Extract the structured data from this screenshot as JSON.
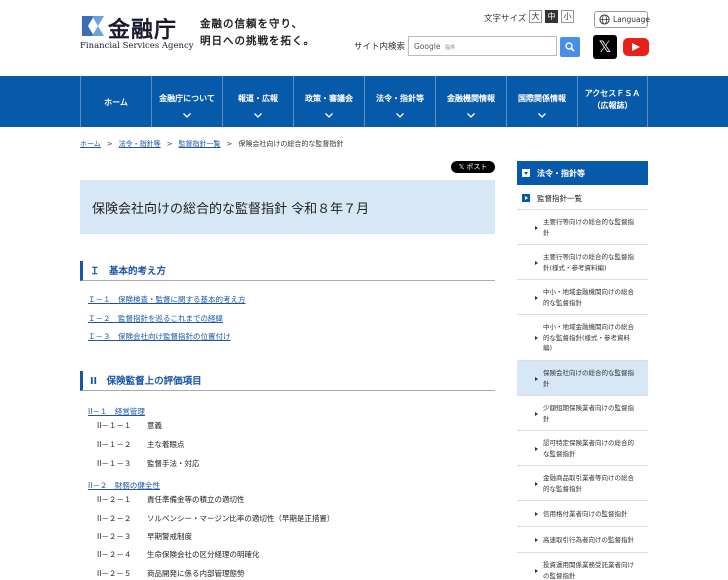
{
  "header": {
    "logo_jp": "金融庁",
    "logo_en": "Financial Services Agency",
    "tagline_line1": "金融の信頼を守り、",
    "tagline_line2": "明日への挑戦を拓く。",
    "font_size_label": "文字サイズ",
    "font_sizes": [
      "大",
      "中",
      "小"
    ],
    "language_label": "Language",
    "search_label": "サイト内検索",
    "search_google": "Google",
    "search_powered": "提供",
    "x_label": "𝕏"
  },
  "nav": {
    "items": [
      {
        "label": "ホーム"
      },
      {
        "label": "金融庁について"
      },
      {
        "label": "報道・広報"
      },
      {
        "label": "政策・審議会"
      },
      {
        "label": "法令・指針等"
      },
      {
        "label": "金融機関情報"
      },
      {
        "label": "国際関係情報"
      },
      {
        "label_line1": "アクセスＦＳＡ",
        "label_line2": "（広報誌）"
      }
    ]
  },
  "breadcrumb": {
    "items": [
      "ホーム",
      "法令・指針等",
      "監督指針一覧",
      "保険会社向けの総合的な監督指針"
    ],
    "separator": ">"
  },
  "post_button": "𝕏 ポスト",
  "main": {
    "title": "保険会社向けの総合的な監督指針 令和８年７月",
    "section1": {
      "heading": "Ｉ　基本的考え方",
      "links": [
        "Ｉ－１　保険検査・監督に関する基本的考え方",
        "Ｉ－２　監督指針を巡るこれまでの経緯",
        "Ｉ－３　保険会社向け監督指針の位置付け"
      ]
    },
    "section2": {
      "heading": "II　保険監督上の評価項目",
      "sub1": {
        "link": "II－１　経営管理",
        "items": [
          {
            "code": "II－１－１",
            "text": "意義"
          },
          {
            "code": "II－１－２",
            "text": "主な着眼点"
          },
          {
            "code": "II－１－３",
            "text": "監督手法・対応"
          }
        ]
      },
      "sub2": {
        "link": "II－２　財務の健全性",
        "items": [
          {
            "code": "II－２－１",
            "text": "責任準備金等の積立の適切性"
          },
          {
            "code": "II－２－２",
            "text": "ソルベンシー・マージン比率の適切性（早期是正措置）"
          },
          {
            "code": "II－２－３",
            "text": "早期警戒制度"
          },
          {
            "code": "II－２－４",
            "text": "生命保険会社の区分経理の明確化"
          },
          {
            "code": "II－２－５",
            "text": "商品開発に係る内部管理態勢"
          }
        ]
      }
    }
  },
  "sidebar": {
    "heading": "法令・指針等",
    "level1": "監督指針一覧",
    "items": [
      {
        "lines": [
          "主要行等向けの総合的な監督指",
          "針"
        ]
      },
      {
        "lines": [
          "主要行等向けの総合的な監督指",
          "針(様式・参考資料編)"
        ]
      },
      {
        "lines": [
          "中小・地域金融機関向けの総合",
          "的な監督指針"
        ]
      },
      {
        "lines": [
          "中小・地域金融機関向けの総合",
          "的な監督指針(様式・参考資料",
          "編)"
        ]
      },
      {
        "lines": [
          "保険会社向けの総合的な監督指",
          "針"
        ],
        "selected": true
      },
      {
        "lines": [
          "少額短期保険業者向けの監督指",
          "針"
        ]
      },
      {
        "lines": [
          "認可特定保険業者向けの総合的",
          "な監督指針"
        ]
      },
      {
        "lines": [
          "金融商品取引業者等向けの総合",
          "的な監督指針"
        ]
      },
      {
        "lines": [
          "信用格付業者向けの監督指針"
        ]
      },
      {
        "lines": [
          "高速取引行為者向けの監督指針"
        ]
      },
      {
        "lines": [
          "投資運用関係業務受託業者向け",
          "の監督指針"
        ]
      }
    ]
  },
  "colors": {
    "nav_bg": "#0759aa",
    "link": "#1a55a8",
    "title_bg": "#d7e7f5"
  }
}
